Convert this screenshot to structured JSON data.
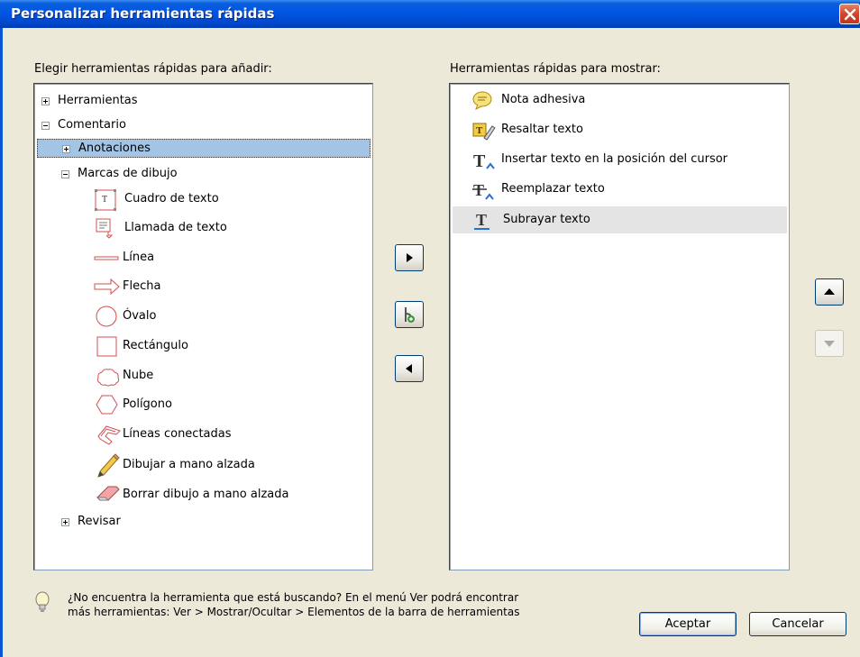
{
  "window": {
    "title": "Personalizar herramientas rápidas"
  },
  "left_panel": {
    "label": "Elegir herramientas rápidas para añadir:",
    "tree": {
      "herramientas": "Herramientas",
      "comentario": "Comentario",
      "anotaciones": "Anotaciones",
      "marcas": "Marcas de dibujo",
      "items": [
        "Cuadro de texto",
        "Llamada de texto",
        "Línea",
        "Flecha",
        "Óvalo",
        "Rectángulo",
        "Nube",
        "Polígono",
        "Líneas conectadas",
        "Dibujar a mano alzada",
        "Borrar dibujo a mano alzada"
      ],
      "revisar": "Revisar"
    }
  },
  "right_panel": {
    "label": "Herramientas rápidas para mostrar:",
    "items": [
      "Nota adhesiva",
      "Resaltar texto",
      "Insertar texto en la posición del cursor",
      "Reemplazar texto",
      "Subrayar texto"
    ],
    "selected_index": 4
  },
  "hint": {
    "line1": "¿No encuentra la herramienta que está buscando? En el menú Ver podrá encontrar",
    "line2": "más herramientas: Ver > Mostrar/Ocultar > Elementos de la barra de herramientas"
  },
  "buttons": {
    "ok": "Aceptar",
    "cancel": "Cancelar"
  },
  "icons": {
    "add": "arrow-right-icon",
    "add_separator": "add-separator-icon",
    "remove": "arrow-left-icon",
    "move_up": "arrow-up-icon",
    "move_down": "arrow-down-icon",
    "hint": "lightbulb-icon"
  },
  "colors": {
    "titlebar": "#0055e5",
    "selection": "#a4c4e6",
    "dialog_bg": "#ece9d8"
  }
}
